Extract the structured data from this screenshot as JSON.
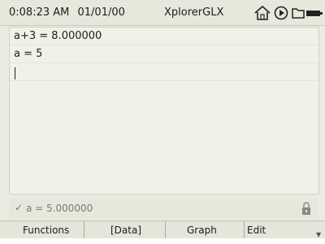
{
  "status": {
    "time": "0:08:23 AM",
    "date": "01/01/00",
    "app_name": "XplorerGLX",
    "icons": [
      "home-icon",
      "play-icon",
      "folder-icon",
      "battery-icon"
    ]
  },
  "editor": {
    "lines": [
      "a+3 = 8.000000",
      "a = 5",
      ""
    ]
  },
  "result": {
    "check_glyph": "✓",
    "text": "a = 5.000000",
    "lock_icon": "lock-icon"
  },
  "softkeys": {
    "f1": "Functions",
    "f2": "[Data]",
    "f3": "Graph",
    "f4": "Edit",
    "f4_arrow": "▼"
  }
}
